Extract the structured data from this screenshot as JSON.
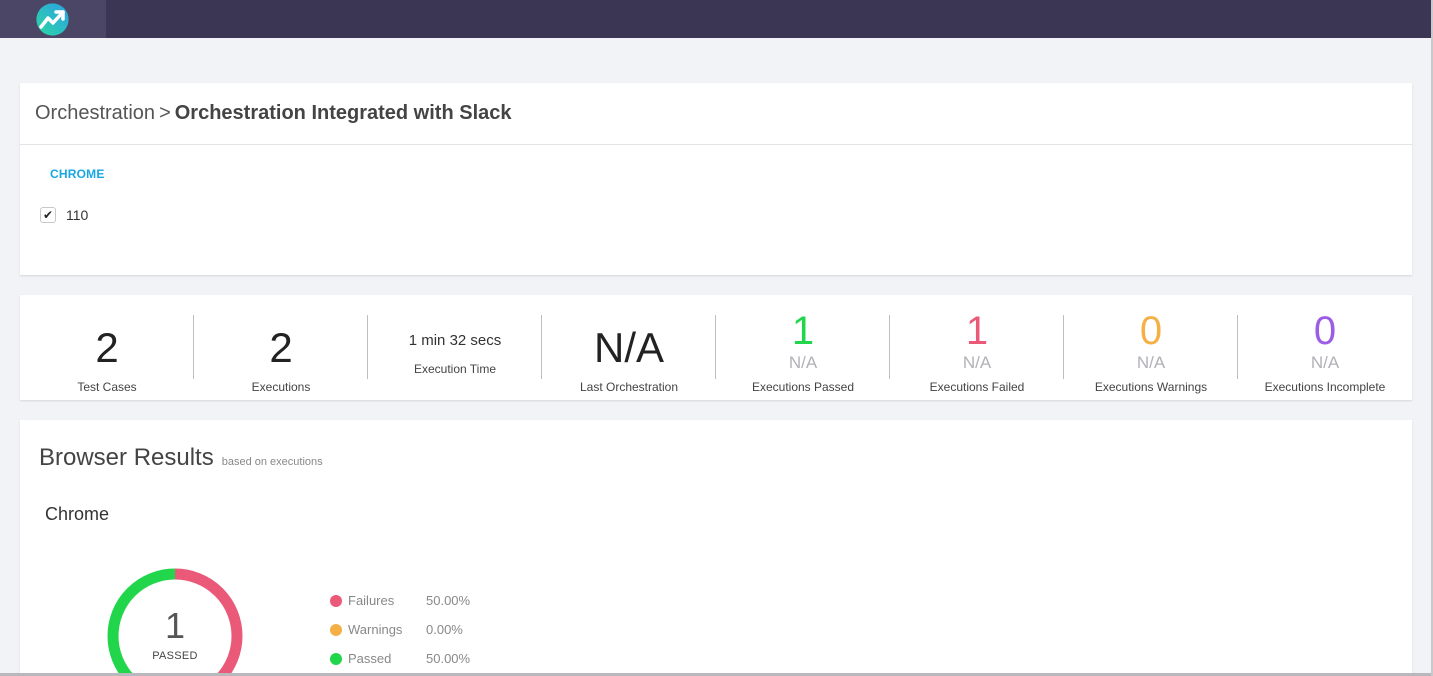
{
  "colors": {
    "topbar": "#3b3653",
    "accent": "#17a8e3",
    "passed": "#22d64b",
    "failed": "#ea5a78",
    "warnings": "#f5b045",
    "incomplete": "#9b5de5"
  },
  "header": {
    "logo_icon": "trending-chart-icon"
  },
  "breadcrumb": {
    "parent": "Orchestration",
    "separator": ">",
    "current": "Orchestration Integrated with Slack"
  },
  "browsers": {
    "title": "CHROME",
    "version": "110",
    "version_checked": true
  },
  "stats": {
    "test_cases": {
      "value": "2",
      "label": "Test Cases"
    },
    "executions": {
      "value": "2",
      "label": "Executions"
    },
    "execution_time": {
      "value": "1 min 32 secs",
      "label": "Execution Time"
    },
    "last_orchestration": {
      "value": "N/A",
      "label": "Last Orchestration"
    },
    "passed": {
      "value": "1",
      "sub": "N/A",
      "label": "Executions Passed"
    },
    "failed": {
      "value": "1",
      "sub": "N/A",
      "label": "Executions Failed"
    },
    "warnings": {
      "value": "0",
      "sub": "N/A",
      "label": "Executions Warnings"
    },
    "incomplete": {
      "value": "0",
      "sub": "N/A",
      "label": "Executions Incomplete"
    }
  },
  "results": {
    "title": "Browser Results",
    "subtitle": "based on executions",
    "browser_name": "Chrome",
    "donut_value": "1",
    "donut_label": "PASSED",
    "legend": [
      {
        "name": "Failures",
        "value": "50.00%",
        "fraction": 0.5,
        "color": "#ea5a78"
      },
      {
        "name": "Warnings",
        "value": "0.00%",
        "fraction": 0.0,
        "color": "#f5b045"
      },
      {
        "name": "Passed",
        "value": "50.00%",
        "fraction": 0.5,
        "color": "#22d64b"
      }
    ]
  }
}
